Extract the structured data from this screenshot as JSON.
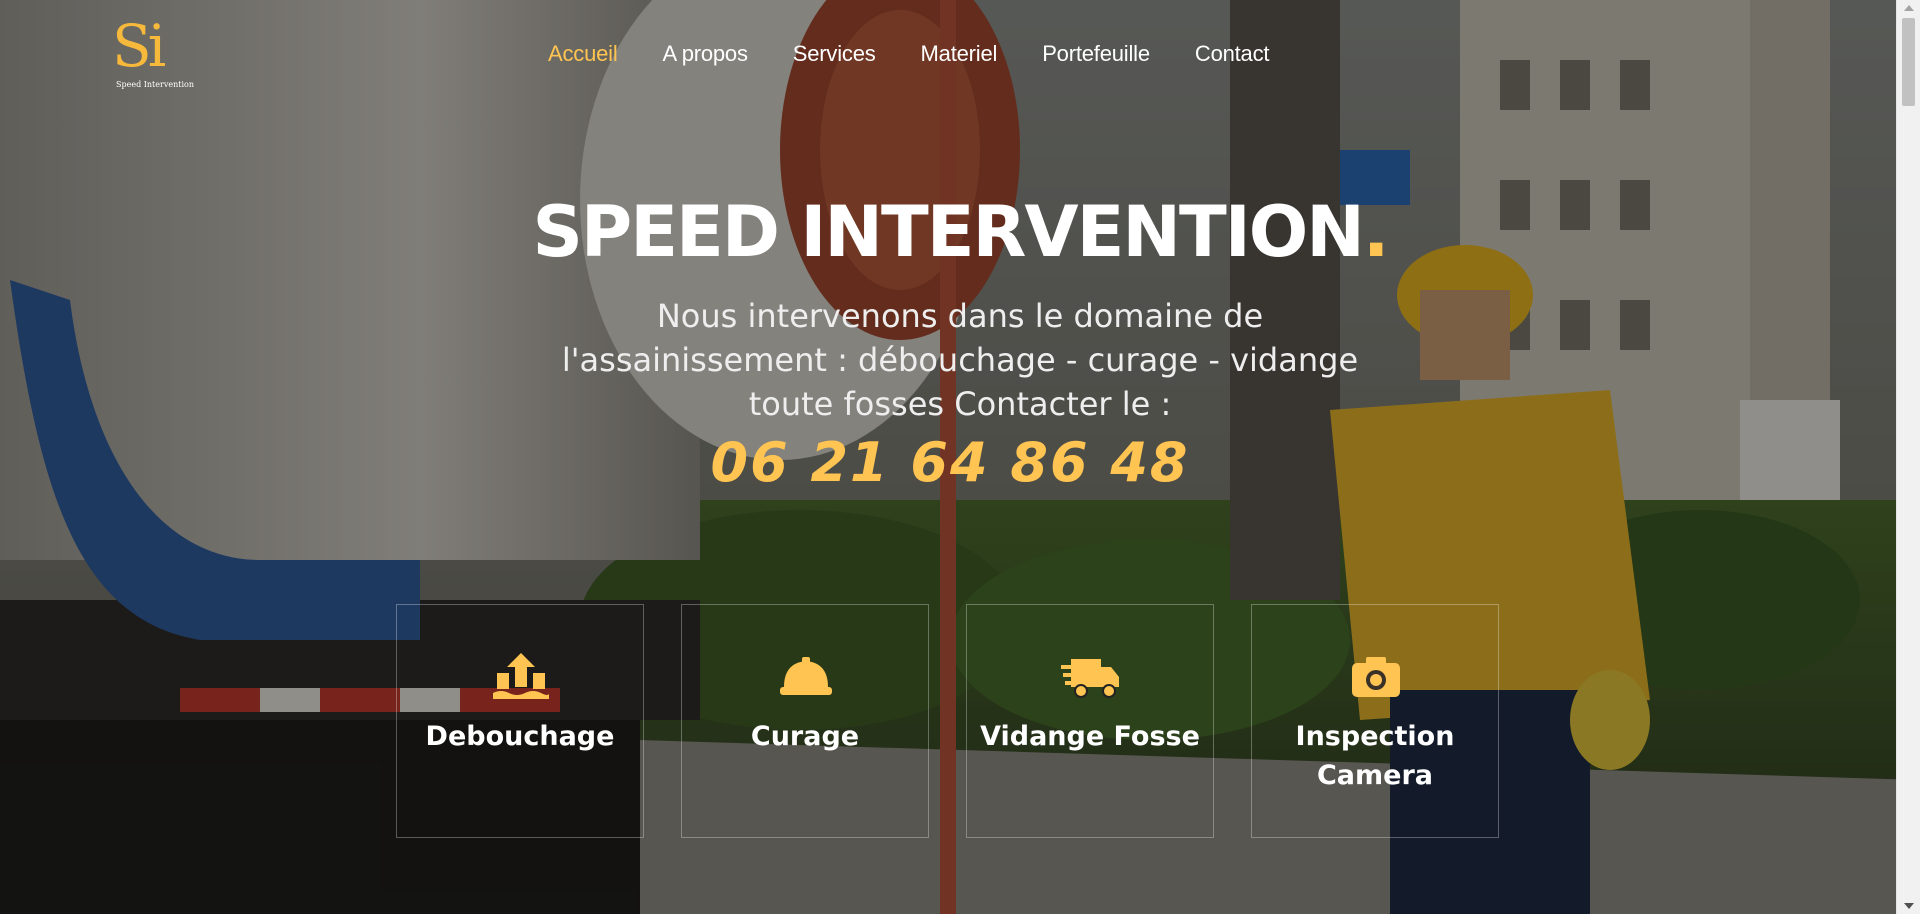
{
  "brand": {
    "logo_letters": "Si",
    "tagline": "Speed Intervention"
  },
  "nav": {
    "items": [
      {
        "label": "Accueil",
        "active": true
      },
      {
        "label": "A propos",
        "active": false
      },
      {
        "label": "Services",
        "active": false
      },
      {
        "label": "Materiel",
        "active": false
      },
      {
        "label": "Portefeuille",
        "active": false
      },
      {
        "label": "Contact",
        "active": false
      }
    ]
  },
  "hero": {
    "title": "SPEED INTERVENTION",
    "title_dot": ".",
    "subtitle": "Nous intervenons dans le domaine de l'assainissement : débouchage - curage - vidange toute fosses Contacter le :",
    "phone": "06 21 64 86 48"
  },
  "services": [
    {
      "label": "Debouchage",
      "icon": "upload-water-icon"
    },
    {
      "label": "Curage",
      "icon": "hard-hat-icon"
    },
    {
      "label": "Vidange Fosse",
      "icon": "truck-fast-icon"
    },
    {
      "label": "Inspection Camera",
      "icon": "camera-icon"
    }
  ],
  "colors": {
    "accent": "#ffc451",
    "text": "#ffffff"
  }
}
